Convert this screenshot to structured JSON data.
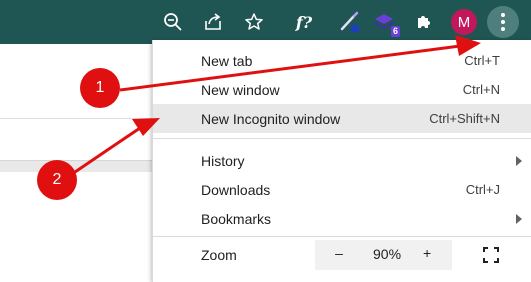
{
  "toolbar": {
    "icons": [
      "zoom-icon",
      "share-icon",
      "bookmark-star-icon",
      "font-extension-icon",
      "pen-extension-icon",
      "stack-extension-icon",
      "extensions-puzzle-icon"
    ],
    "font_ext_label": "f?",
    "stack_ext_badge": "6",
    "avatar_initial": "M",
    "colors": {
      "bar": "#1f5552",
      "avatar": "#c2185b",
      "badge_purple": "#6a3fd8",
      "badge_blue": "#1a3fc0"
    }
  },
  "menu": {
    "new_tab": {
      "label": "New tab",
      "shortcut": "Ctrl+T"
    },
    "new_window": {
      "label": "New window",
      "shortcut": "Ctrl+N"
    },
    "new_incognito": {
      "label": "New Incognito window",
      "shortcut": "Ctrl+Shift+N"
    },
    "history": {
      "label": "History"
    },
    "downloads": {
      "label": "Downloads",
      "shortcut": "Ctrl+J"
    },
    "bookmarks": {
      "label": "Bookmarks"
    },
    "zoom": {
      "label": "Zoom",
      "minus": "–",
      "value": "90%",
      "plus": "+"
    }
  },
  "annotations": {
    "badge1": "1",
    "badge2": "2",
    "color": "#e01010"
  }
}
